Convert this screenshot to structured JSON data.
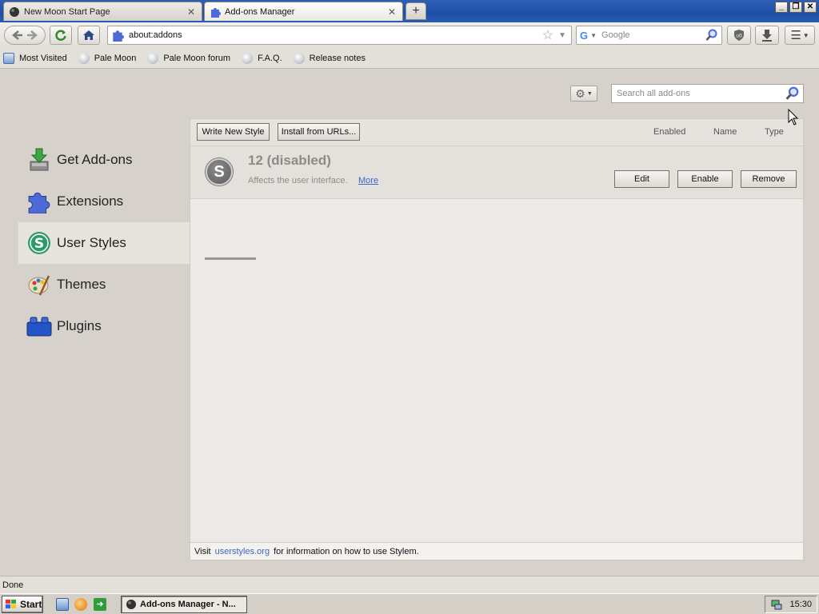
{
  "window": {
    "controls": [
      "_",
      "❐",
      "✕"
    ]
  },
  "tabs": [
    {
      "label": "New Moon Start Page",
      "active": false
    },
    {
      "label": "Add-ons Manager",
      "active": true
    }
  ],
  "new_tab_label": "+",
  "navbar": {
    "url": "about:addons",
    "search_placeholder": "Google"
  },
  "bookmarks": [
    {
      "label": "Most Visited",
      "icon": "folder-icon"
    },
    {
      "label": "Pale Moon",
      "icon": "globe-icon"
    },
    {
      "label": "Pale Moon forum",
      "icon": "globe-icon"
    },
    {
      "label": "F.A.Q.",
      "icon": "globe-icon"
    },
    {
      "label": "Release notes",
      "icon": "globe-icon"
    }
  ],
  "addons": {
    "search_placeholder": "Search all add-ons",
    "categories": [
      {
        "label": "Get Add-ons",
        "icon": "get-addons-icon",
        "selected": false
      },
      {
        "label": "Extensions",
        "icon": "puzzle-icon",
        "selected": false
      },
      {
        "label": "User Styles",
        "icon": "stylish-icon",
        "selected": true
      },
      {
        "label": "Themes",
        "icon": "palette-icon",
        "selected": false
      },
      {
        "label": "Plugins",
        "icon": "lego-icon",
        "selected": false
      }
    ],
    "toolbar": {
      "write_new_style": "Write New Style",
      "install_from_urls": "Install from URLs...",
      "sort_enabled": "Enabled",
      "sort_name": "Name",
      "sort_type": "Type"
    },
    "item": {
      "name": "12  (disabled)",
      "icon_letter": "S",
      "description": "Affects the user interface.",
      "more": "More",
      "edit": "Edit",
      "enable": "Enable",
      "remove": "Remove"
    },
    "footer": {
      "prefix": "Visit",
      "link": "userstyles.org",
      "suffix": "for information on how to use Stylem."
    }
  },
  "statusbar": {
    "text": "Done"
  },
  "taskbar": {
    "start": "Start",
    "task": "Add-ons Manager - N...",
    "clock": "15:30"
  },
  "colors": {
    "title_blue": "#2f5fb5",
    "link_blue": "#3a67c8",
    "stylish_green": "#2e9a6a"
  }
}
